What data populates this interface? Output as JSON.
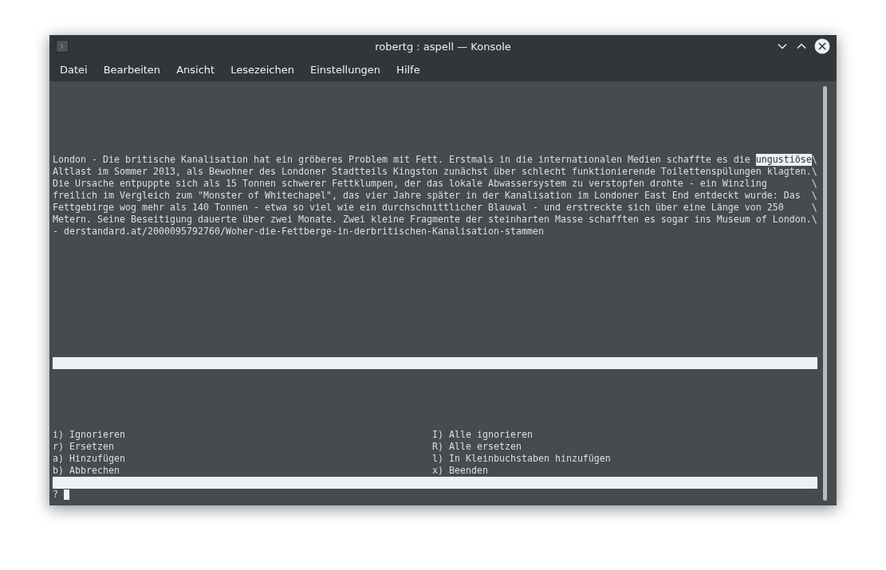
{
  "window": {
    "title": "robertg : aspell — Konsole"
  },
  "menu": [
    "Datei",
    "Bearbeiten",
    "Ansicht",
    "Lesezeichen",
    "Einstellungen",
    "Hilfe"
  ],
  "terminal": {
    "article_lines": [
      [
        {
          "text": "London - Die britische Kanalisation hat ein gröberes Problem mit Fett. Erstmals in die internationalen Medien schaffte es die ",
          "highlighted": false
        },
        {
          "text": "ungustiöse",
          "highlighted": true
        },
        {
          "text": "\\",
          "highlighted": false
        }
      ],
      [
        {
          "text": "Altlast im Sommer 2013, als Bewohner des Londoner Stadtteils Kingston zunächst über schlecht funktionierende Toilettenspülungen klagten.\\",
          "highlighted": false
        }
      ],
      [
        {
          "text": "Die Ursache entpuppte sich als 15 Tonnen schwerer Fettklumpen, der das lokale Abwassersystem zu verstopfen drohte - ein Winzling        \\",
          "highlighted": false
        }
      ],
      [
        {
          "text": "freilich im Vergleich zum \"Monster of Whitechapel\", das vier Jahre später in der Kanalisation im Londoner East End entdeckt wurde: Das  \\",
          "highlighted": false
        }
      ],
      [
        {
          "text": "Fettgebirge wog mehr als 140 Tonnen - etwa so viel wie ein durchschnittlicher Blauwal - und erstreckte sich über eine Länge von 250     \\",
          "highlighted": false
        }
      ],
      [
        {
          "text": "Metern. Seine Beseitigung dauerte über zwei Monate. Zwei kleine Fragmente der steinharten Masse schafften es sogar ins Museum of London.\\",
          "highlighted": false
        }
      ],
      [
        {
          "text": "- derstandard.at/2000095792760/Woher-die-Fettberge-in-derbritischen-Kanalisation-stammen",
          "highlighted": false
        }
      ]
    ],
    "options": [
      {
        "left": "i) Ignorieren",
        "right": "I) Alle ignorieren"
      },
      {
        "left": "r) Ersetzen",
        "right": "R) Alle ersetzen"
      },
      {
        "left": "a) Hinzufügen",
        "right": "l) In Kleinbuchstaben hinzufügen"
      },
      {
        "left": "b) Abbrechen",
        "right": "x) Beenden"
      }
    ],
    "prompt": {
      "text": "?",
      "cursor": true
    }
  }
}
